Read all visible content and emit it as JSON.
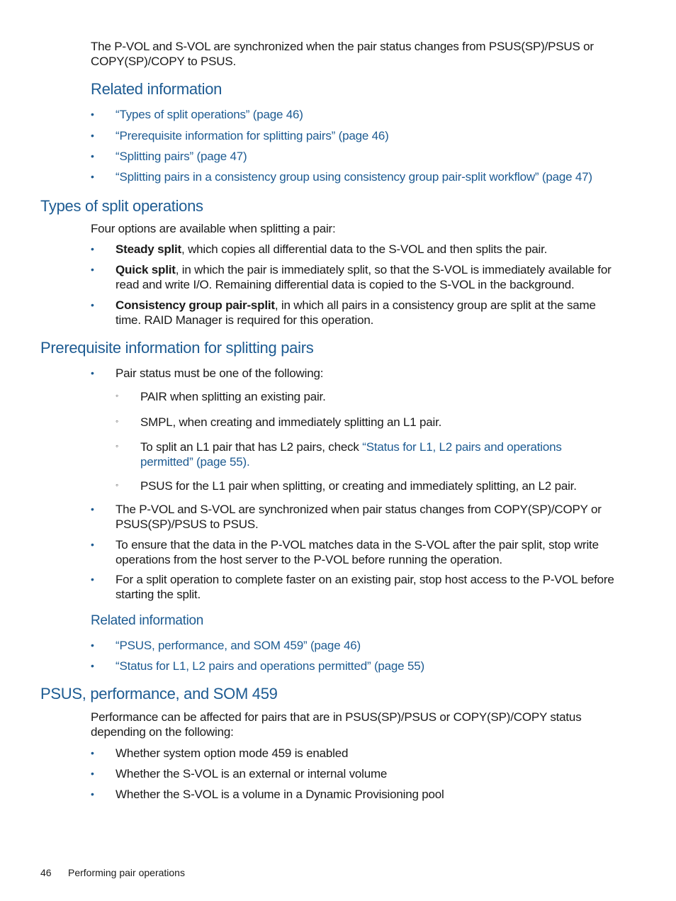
{
  "intro": {
    "text": "The P-VOL and S-VOL are synchronized when the pair status changes from PSUS(SP)/PSUS or COPY(SP)/COPY to PSUS."
  },
  "related1": {
    "heading": "Related information",
    "links": [
      "“Types of split operations” (page 46)",
      "“Prerequisite information for splitting pairs” (page 46)",
      "“Splitting pairs” (page 47)",
      "“Splitting pairs in a consistency group using consistency group pair-split workflow” (page 47)"
    ]
  },
  "types": {
    "heading": "Types of split operations",
    "intro": "Four options are available when splitting a pair:",
    "items": [
      {
        "term": "Steady split",
        "rest": ", which copies all differential data to the S-VOL and then splits the pair."
      },
      {
        "term": "Quick split",
        "rest": ", in which the pair is immediately split, so that the S-VOL is immediately available for read and write I/O. Remaining differential data is copied to the S-VOL in the background."
      },
      {
        "term": "Consistency group pair-split",
        "rest": ", in which all pairs in a consistency group are split at the same time. RAID Manager is required for this operation."
      }
    ]
  },
  "prereq": {
    "heading": "Prerequisite information for splitting pairs",
    "items": [
      "Pair status must be one of the following:",
      "The P-VOL and S-VOL are synchronized when pair status changes from COPY(SP)/COPY or PSUS(SP)/PSUS to PSUS.",
      "To ensure that the data in the P-VOL matches data in the S-VOL after the pair split, stop write operations from the host server to the P-VOL before running the operation.",
      "For a split operation to complete faster on an existing pair, stop host access to the P-VOL before starting the split."
    ],
    "subitems": {
      "pair": "PAIR when splitting an existing pair.",
      "smpl": "SMPL, when creating and immediately splitting an L1 pair.",
      "l1_prefix": "To split an L1 pair that has L2 pairs, check ",
      "l1_link": "“Status for L1, L2 pairs and operations permitted” (page 55).",
      "psus": "PSUS for the L1 pair when splitting, or creating and immediately splitting, an L2 pair."
    },
    "related": {
      "heading": "Related information",
      "links": [
        "“PSUS, performance, and SOM 459” (page 46)",
        "“Status for L1, L2 pairs and operations permitted” (page 55)"
      ]
    }
  },
  "psus": {
    "heading": "PSUS, performance, and SOM 459",
    "intro": "Performance can be affected for pairs that are in PSUS(SP)/PSUS or COPY(SP)/COPY status depending on the following:",
    "items": [
      "Whether system option mode 459 is enabled",
      "Whether the S-VOL is an external or internal volume",
      "Whether the S-VOL is a volume in a Dynamic Provisioning pool"
    ]
  },
  "footer": {
    "page_number": "46",
    "chapter_title": "Performing pair operations"
  },
  "bullets": {
    "primary": "•",
    "secondary": "◦"
  },
  "colors": {
    "accent": "#1d5b92",
    "text": "#1a1a1a"
  }
}
